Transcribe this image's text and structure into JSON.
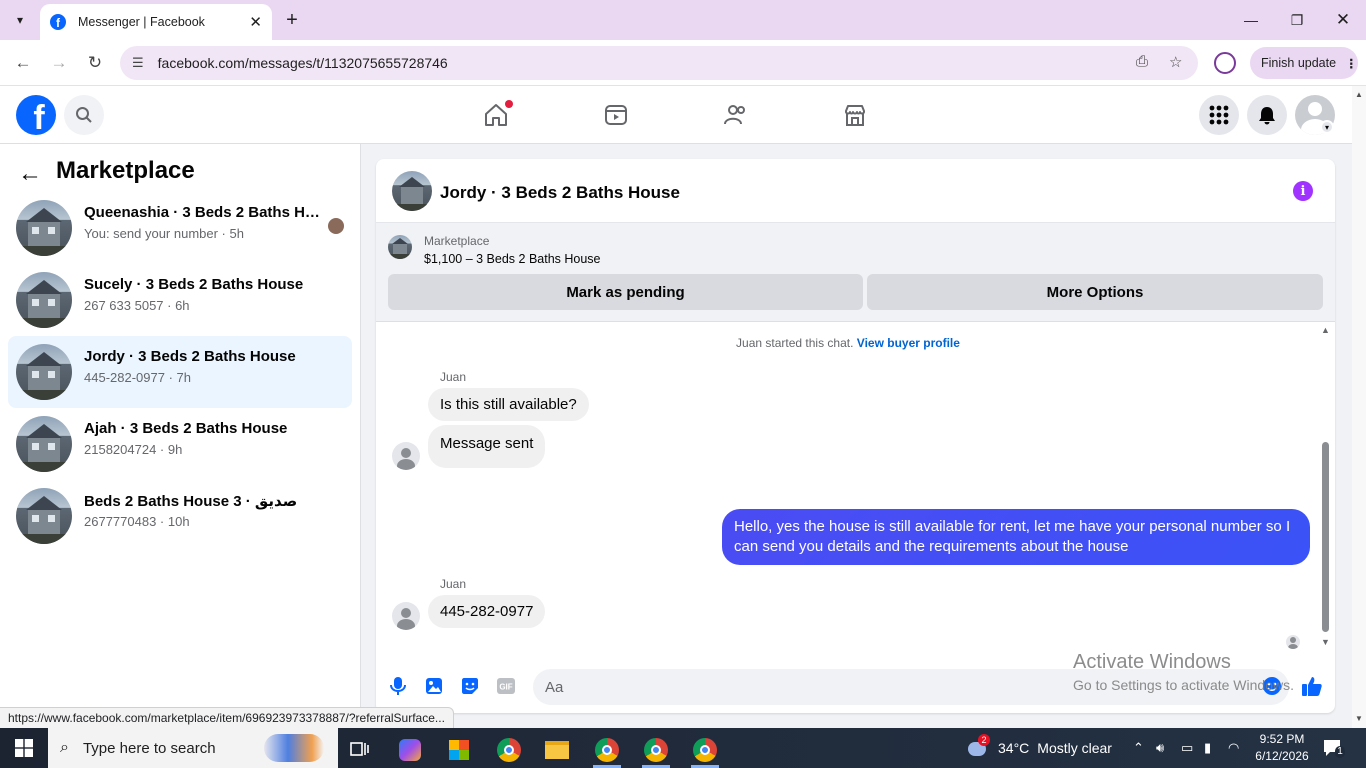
{
  "browser": {
    "tab_title": "Messenger | Facebook",
    "url": "facebook.com/messages/t/1132075655728746",
    "finish_update": "Finish update",
    "status_url": "https://www.facebook.com/marketplace/item/696923973378887/?referralSurface..."
  },
  "sidebar": {
    "title": "Marketplace",
    "conversations": [
      {
        "name": "Queenashia · 3 Beds 2 Baths Ho...",
        "sub": "You: send your number · 5h"
      },
      {
        "name": "Sucely · 3 Beds 2 Baths House",
        "sub": "267 633 5057 · 6h"
      },
      {
        "name": "Jordy · 3 Beds 2 Baths House",
        "sub": "445-282-0977 · 7h"
      },
      {
        "name": "Ajah · 3 Beds 2 Baths House",
        "sub": "2158204724 · 9h"
      },
      {
        "name": "صديق · 3 Beds 2 Baths House",
        "sub": "2677770483 · 10h"
      }
    ]
  },
  "chat": {
    "title": "Jordy · 3 Beds 2 Baths House",
    "marketplace_label": "Marketplace",
    "listing": "$1,100 – 3 Beds 2 Baths House",
    "mark_pending": "Mark as pending",
    "more_options": "More Options",
    "system_msg": "Juan started this chat.",
    "view_profile": "View buyer profile",
    "sender1": "Juan",
    "msg1": "Is this still available?",
    "msg2": "Message sent",
    "outgoing": "Hello, yes the house is still available for rent, let me have your personal number so I can send you details and the requirements about the house",
    "sender2": "Juan",
    "msg3": "445-282-0977",
    "input_placeholder": "Aa"
  },
  "watermark": {
    "line1": "Activate Windows",
    "line2": "Go to Settings to activate Windows."
  },
  "taskbar": {
    "search_placeholder": "Type here to search",
    "weather_temp": "34°C",
    "weather_desc": "Mostly clear",
    "weather_badge": "2",
    "time": "9:52 PM",
    "date": "6/12/2026",
    "notif_count": "1"
  },
  "colors": {
    "accent": "#0866ff",
    "outgoing_bubble": "#3a52f7",
    "active_conv": "#ebf5ff",
    "info": "#a033ff"
  }
}
